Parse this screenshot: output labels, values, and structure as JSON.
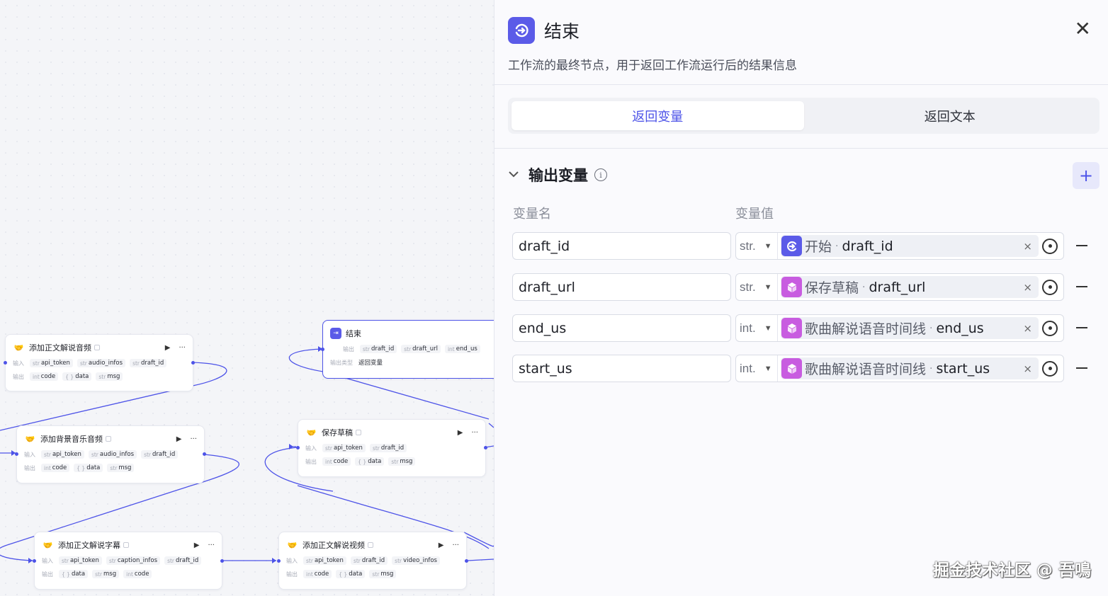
{
  "canvas": {
    "nodes": [
      {
        "title": "添加正文解说音频",
        "inputs": [
          [
            "str",
            "api_token"
          ],
          [
            "str",
            "audio_infos"
          ],
          [
            "str",
            "draft_id"
          ]
        ],
        "outputs": [
          [
            "int",
            "code"
          ],
          [
            "{ }",
            "data"
          ],
          [
            "str",
            "msg"
          ]
        ]
      },
      {
        "title": "添加背景音乐音频",
        "inputs": [
          [
            "str",
            "api_token"
          ],
          [
            "str",
            "audio_infos"
          ],
          [
            "str",
            "draft_id"
          ]
        ],
        "outputs": [
          [
            "int",
            "code"
          ],
          [
            "{ }",
            "data"
          ],
          [
            "str",
            "msg"
          ]
        ]
      },
      {
        "title": "添加正文解说字幕",
        "inputs": [
          [
            "str",
            "api_token"
          ],
          [
            "str",
            "caption_infos"
          ],
          [
            "str",
            "draft_id"
          ]
        ],
        "outputs": [
          [
            "{ }",
            "data"
          ],
          [
            "str",
            "msg"
          ],
          [
            "int",
            "code"
          ]
        ]
      },
      {
        "title": "保存草稿",
        "inputs": [
          [
            "str",
            "api_token"
          ],
          [
            "str",
            "draft_id"
          ]
        ],
        "outputs": [
          [
            "int",
            "code"
          ],
          [
            "{ }",
            "data"
          ],
          [
            "str",
            "msg"
          ]
        ]
      },
      {
        "title": "添加正文解说视频",
        "inputs": [
          [
            "str",
            "api_token"
          ],
          [
            "str",
            "draft_id"
          ],
          [
            "str",
            "video_infos"
          ]
        ],
        "outputs": [
          [
            "int",
            "code"
          ],
          [
            "{ }",
            "data"
          ],
          [
            "str",
            "msg"
          ]
        ]
      }
    ],
    "end_node": {
      "title": "结束",
      "output_label": "输出",
      "outputs": [
        [
          "str",
          "draft_id"
        ],
        [
          "str",
          "draft_url"
        ],
        [
          "int",
          "end_us"
        ]
      ],
      "type_label": "输出类型",
      "type_value": "返回变量"
    },
    "input_label": "输入",
    "output_label": "输出",
    "run_icon": "▶",
    "more_icon": "···"
  },
  "panel": {
    "title": "结束",
    "description": "工作流的最终节点，用于返回工作流运行后的结果信息",
    "close_icon": "✕",
    "tabs": [
      {
        "label": "返回变量",
        "active": true
      },
      {
        "label": "返回文本",
        "active": false
      }
    ],
    "section_title": "输出变量",
    "add_icon": "+",
    "col_name": "变量名",
    "col_value": "变量值",
    "rows": [
      {
        "name": "draft_id",
        "type": "str.",
        "source": "开始",
        "var": "draft_id",
        "icon_color": "#5b5be8",
        "icon": "start-icon"
      },
      {
        "name": "draft_url",
        "type": "str.",
        "source": "保存草稿",
        "var": "draft_url",
        "icon_color": "#c85ce0",
        "icon": "plugin-icon"
      },
      {
        "name": "end_us",
        "type": "int.",
        "source": "歌曲解说语音时间线",
        "var": "end_us",
        "icon_color": "#c85ce0",
        "icon": "plugin-icon"
      },
      {
        "name": "start_us",
        "type": "int.",
        "source": "歌曲解说语音时间线",
        "var": "start_us",
        "icon_color": "#c85ce0",
        "icon": "plugin-icon"
      }
    ],
    "ref_separator": "·",
    "remove_icon": "×"
  },
  "watermark": "掘金技术社区 @ 吾鳴"
}
